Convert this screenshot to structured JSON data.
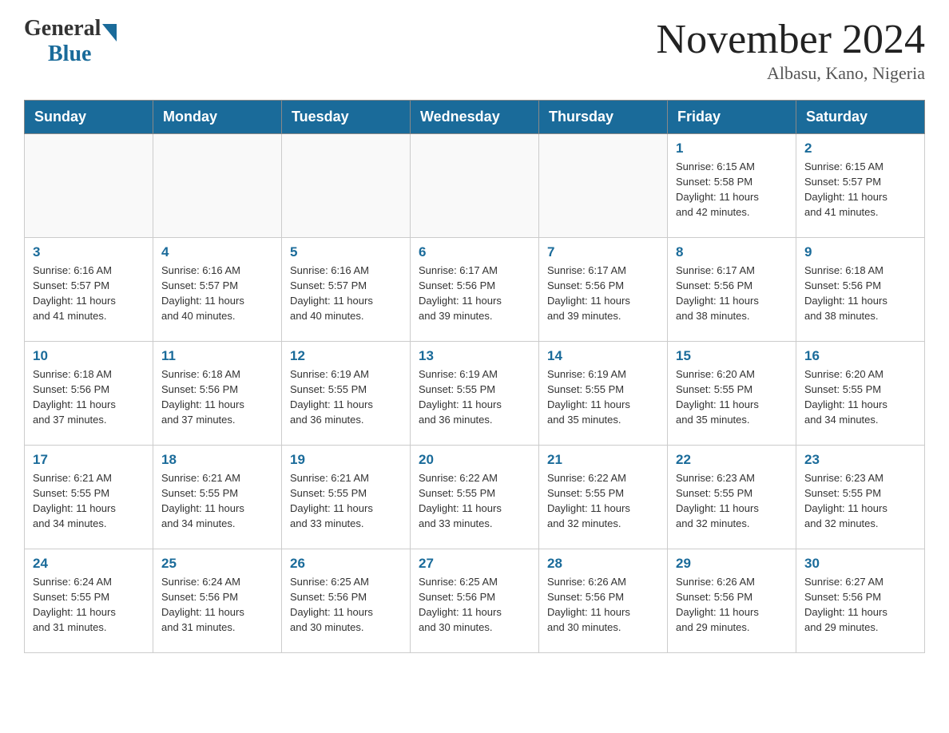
{
  "header": {
    "logo_general": "General",
    "logo_blue": "Blue",
    "month_title": "November 2024",
    "location": "Albasu, Kano, Nigeria"
  },
  "weekdays": [
    "Sunday",
    "Monday",
    "Tuesday",
    "Wednesday",
    "Thursday",
    "Friday",
    "Saturday"
  ],
  "weeks": [
    [
      {
        "day": "",
        "info": ""
      },
      {
        "day": "",
        "info": ""
      },
      {
        "day": "",
        "info": ""
      },
      {
        "day": "",
        "info": ""
      },
      {
        "day": "",
        "info": ""
      },
      {
        "day": "1",
        "info": "Sunrise: 6:15 AM\nSunset: 5:58 PM\nDaylight: 11 hours\nand 42 minutes."
      },
      {
        "day": "2",
        "info": "Sunrise: 6:15 AM\nSunset: 5:57 PM\nDaylight: 11 hours\nand 41 minutes."
      }
    ],
    [
      {
        "day": "3",
        "info": "Sunrise: 6:16 AM\nSunset: 5:57 PM\nDaylight: 11 hours\nand 41 minutes."
      },
      {
        "day": "4",
        "info": "Sunrise: 6:16 AM\nSunset: 5:57 PM\nDaylight: 11 hours\nand 40 minutes."
      },
      {
        "day": "5",
        "info": "Sunrise: 6:16 AM\nSunset: 5:57 PM\nDaylight: 11 hours\nand 40 minutes."
      },
      {
        "day": "6",
        "info": "Sunrise: 6:17 AM\nSunset: 5:56 PM\nDaylight: 11 hours\nand 39 minutes."
      },
      {
        "day": "7",
        "info": "Sunrise: 6:17 AM\nSunset: 5:56 PM\nDaylight: 11 hours\nand 39 minutes."
      },
      {
        "day": "8",
        "info": "Sunrise: 6:17 AM\nSunset: 5:56 PM\nDaylight: 11 hours\nand 38 minutes."
      },
      {
        "day": "9",
        "info": "Sunrise: 6:18 AM\nSunset: 5:56 PM\nDaylight: 11 hours\nand 38 minutes."
      }
    ],
    [
      {
        "day": "10",
        "info": "Sunrise: 6:18 AM\nSunset: 5:56 PM\nDaylight: 11 hours\nand 37 minutes."
      },
      {
        "day": "11",
        "info": "Sunrise: 6:18 AM\nSunset: 5:56 PM\nDaylight: 11 hours\nand 37 minutes."
      },
      {
        "day": "12",
        "info": "Sunrise: 6:19 AM\nSunset: 5:55 PM\nDaylight: 11 hours\nand 36 minutes."
      },
      {
        "day": "13",
        "info": "Sunrise: 6:19 AM\nSunset: 5:55 PM\nDaylight: 11 hours\nand 36 minutes."
      },
      {
        "day": "14",
        "info": "Sunrise: 6:19 AM\nSunset: 5:55 PM\nDaylight: 11 hours\nand 35 minutes."
      },
      {
        "day": "15",
        "info": "Sunrise: 6:20 AM\nSunset: 5:55 PM\nDaylight: 11 hours\nand 35 minutes."
      },
      {
        "day": "16",
        "info": "Sunrise: 6:20 AM\nSunset: 5:55 PM\nDaylight: 11 hours\nand 34 minutes."
      }
    ],
    [
      {
        "day": "17",
        "info": "Sunrise: 6:21 AM\nSunset: 5:55 PM\nDaylight: 11 hours\nand 34 minutes."
      },
      {
        "day": "18",
        "info": "Sunrise: 6:21 AM\nSunset: 5:55 PM\nDaylight: 11 hours\nand 34 minutes."
      },
      {
        "day": "19",
        "info": "Sunrise: 6:21 AM\nSunset: 5:55 PM\nDaylight: 11 hours\nand 33 minutes."
      },
      {
        "day": "20",
        "info": "Sunrise: 6:22 AM\nSunset: 5:55 PM\nDaylight: 11 hours\nand 33 minutes."
      },
      {
        "day": "21",
        "info": "Sunrise: 6:22 AM\nSunset: 5:55 PM\nDaylight: 11 hours\nand 32 minutes."
      },
      {
        "day": "22",
        "info": "Sunrise: 6:23 AM\nSunset: 5:55 PM\nDaylight: 11 hours\nand 32 minutes."
      },
      {
        "day": "23",
        "info": "Sunrise: 6:23 AM\nSunset: 5:55 PM\nDaylight: 11 hours\nand 32 minutes."
      }
    ],
    [
      {
        "day": "24",
        "info": "Sunrise: 6:24 AM\nSunset: 5:55 PM\nDaylight: 11 hours\nand 31 minutes."
      },
      {
        "day": "25",
        "info": "Sunrise: 6:24 AM\nSunset: 5:56 PM\nDaylight: 11 hours\nand 31 minutes."
      },
      {
        "day": "26",
        "info": "Sunrise: 6:25 AM\nSunset: 5:56 PM\nDaylight: 11 hours\nand 30 minutes."
      },
      {
        "day": "27",
        "info": "Sunrise: 6:25 AM\nSunset: 5:56 PM\nDaylight: 11 hours\nand 30 minutes."
      },
      {
        "day": "28",
        "info": "Sunrise: 6:26 AM\nSunset: 5:56 PM\nDaylight: 11 hours\nand 30 minutes."
      },
      {
        "day": "29",
        "info": "Sunrise: 6:26 AM\nSunset: 5:56 PM\nDaylight: 11 hours\nand 29 minutes."
      },
      {
        "day": "30",
        "info": "Sunrise: 6:27 AM\nSunset: 5:56 PM\nDaylight: 11 hours\nand 29 minutes."
      }
    ]
  ]
}
